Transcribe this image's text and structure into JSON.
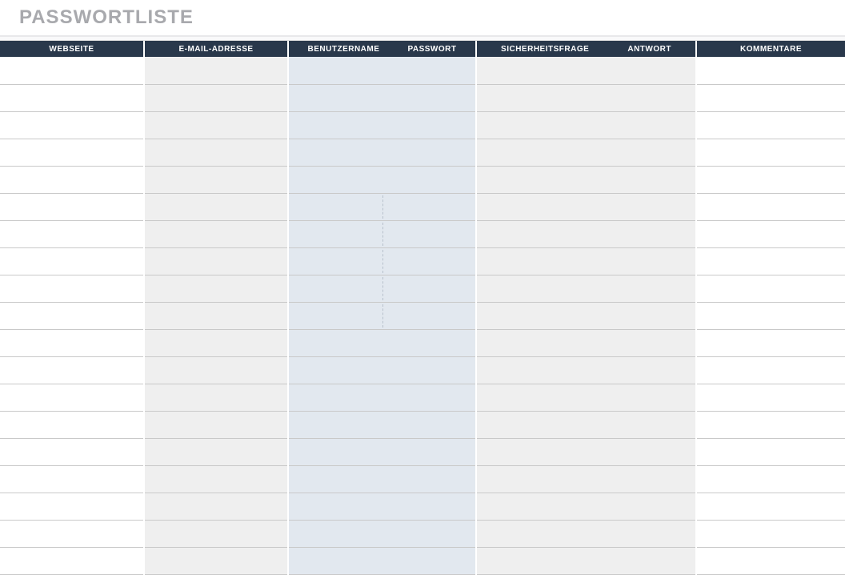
{
  "title": "PASSWORTLISTE",
  "headers": {
    "webseite": "WEBSEITE",
    "email": "E-MAIL-ADRESSE",
    "benutzername": "BENUTZERNAME",
    "passwort": "PASSWORT",
    "sicherheitsfrage": "SICHERHEITSFRAGE",
    "antwort": "ANTWORT",
    "kommentare": "KOMMENTARE"
  },
  "row_count": 19,
  "dashed_divider_rows": [
    5,
    6,
    7,
    8,
    9
  ],
  "rows": [
    {
      "webseite": "",
      "email": "",
      "benutzername": "",
      "passwort": "",
      "sicherheitsfrage": "",
      "antwort": "",
      "kommentare": ""
    },
    {
      "webseite": "",
      "email": "",
      "benutzername": "",
      "passwort": "",
      "sicherheitsfrage": "",
      "antwort": "",
      "kommentare": ""
    },
    {
      "webseite": "",
      "email": "",
      "benutzername": "",
      "passwort": "",
      "sicherheitsfrage": "",
      "antwort": "",
      "kommentare": ""
    },
    {
      "webseite": "",
      "email": "",
      "benutzername": "",
      "passwort": "",
      "sicherheitsfrage": "",
      "antwort": "",
      "kommentare": ""
    },
    {
      "webseite": "",
      "email": "",
      "benutzername": "",
      "passwort": "",
      "sicherheitsfrage": "",
      "antwort": "",
      "kommentare": ""
    },
    {
      "webseite": "",
      "email": "",
      "benutzername": "",
      "passwort": "",
      "sicherheitsfrage": "",
      "antwort": "",
      "kommentare": ""
    },
    {
      "webseite": "",
      "email": "",
      "benutzername": "",
      "passwort": "",
      "sicherheitsfrage": "",
      "antwort": "",
      "kommentare": ""
    },
    {
      "webseite": "",
      "email": "",
      "benutzername": "",
      "passwort": "",
      "sicherheitsfrage": "",
      "antwort": "",
      "kommentare": ""
    },
    {
      "webseite": "",
      "email": "",
      "benutzername": "",
      "passwort": "",
      "sicherheitsfrage": "",
      "antwort": "",
      "kommentare": ""
    },
    {
      "webseite": "",
      "email": "",
      "benutzername": "",
      "passwort": "",
      "sicherheitsfrage": "",
      "antwort": "",
      "kommentare": ""
    },
    {
      "webseite": "",
      "email": "",
      "benutzername": "",
      "passwort": "",
      "sicherheitsfrage": "",
      "antwort": "",
      "kommentare": ""
    },
    {
      "webseite": "",
      "email": "",
      "benutzername": "",
      "passwort": "",
      "sicherheitsfrage": "",
      "antwort": "",
      "kommentare": ""
    },
    {
      "webseite": "",
      "email": "",
      "benutzername": "",
      "passwort": "",
      "sicherheitsfrage": "",
      "antwort": "",
      "kommentare": ""
    },
    {
      "webseite": "",
      "email": "",
      "benutzername": "",
      "passwort": "",
      "sicherheitsfrage": "",
      "antwort": "",
      "kommentare": ""
    },
    {
      "webseite": "",
      "email": "",
      "benutzername": "",
      "passwort": "",
      "sicherheitsfrage": "",
      "antwort": "",
      "kommentare": ""
    },
    {
      "webseite": "",
      "email": "",
      "benutzername": "",
      "passwort": "",
      "sicherheitsfrage": "",
      "antwort": "",
      "kommentare": ""
    },
    {
      "webseite": "",
      "email": "",
      "benutzername": "",
      "passwort": "",
      "sicherheitsfrage": "",
      "antwort": "",
      "kommentare": ""
    },
    {
      "webseite": "",
      "email": "",
      "benutzername": "",
      "passwort": "",
      "sicherheitsfrage": "",
      "antwort": "",
      "kommentare": ""
    },
    {
      "webseite": "",
      "email": "",
      "benutzername": "",
      "passwort": "",
      "sicherheitsfrage": "",
      "antwort": "",
      "kommentare": ""
    }
  ]
}
